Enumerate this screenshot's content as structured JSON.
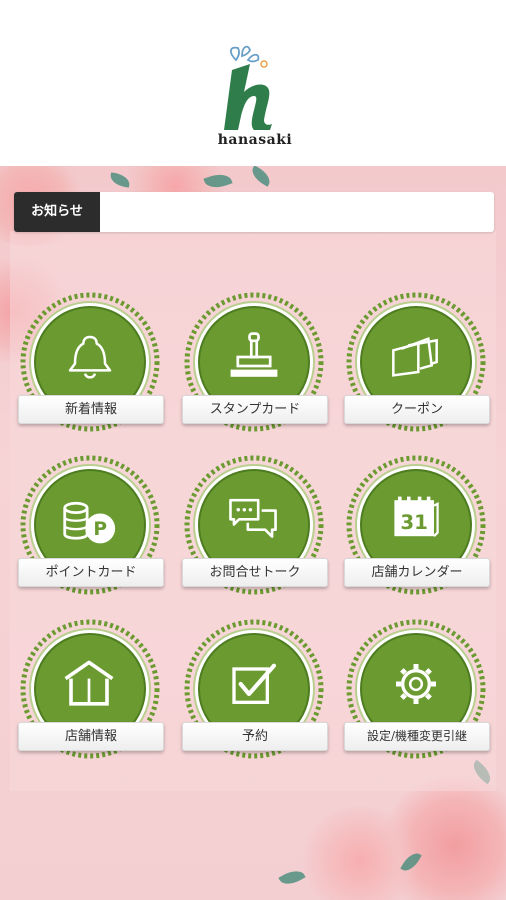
{
  "header": {
    "brand": "hanasaki"
  },
  "notice": {
    "tag_label": "お知らせ",
    "text": ""
  },
  "menu": [
    {
      "label": "新着情報",
      "icon": "bell-icon"
    },
    {
      "label": "スタンプカード",
      "icon": "stamp-icon"
    },
    {
      "label": "クーポン",
      "icon": "coupon-icon"
    },
    {
      "label": "ポイントカード",
      "icon": "point-coin-icon"
    },
    {
      "label": "お問合せトーク",
      "icon": "chat-icon"
    },
    {
      "label": "店舗カレンダー",
      "icon": "calendar-icon",
      "calendar_day": "31"
    },
    {
      "label": "店舗情報",
      "icon": "house-icon"
    },
    {
      "label": "予約",
      "icon": "checkbox-icon"
    },
    {
      "label": "設定/機種変更引継",
      "icon": "gear-icon"
    }
  ],
  "colors": {
    "green": "#6a9a30",
    "background": "#f4cfd2",
    "notice_tag": "#2c2c2c"
  }
}
